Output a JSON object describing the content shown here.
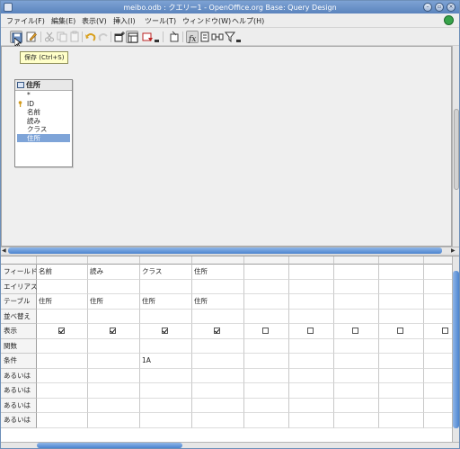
{
  "window": {
    "title": "meibo.odb : クエリー1 - OpenOffice.org Base: Query Design"
  },
  "menu": [
    "ファイル(F)",
    "編集(E)",
    "表示(V)",
    "挿入(I)",
    "ツール(T)",
    "ウィンドウ(W)",
    "ヘルプ(H)"
  ],
  "tooltip": "保存 (Ctrl+S)",
  "table_window": {
    "name": "住所",
    "fields": [
      "*",
      "ID",
      "名前",
      "読み",
      "クラス",
      "住所"
    ],
    "selected": "住所"
  },
  "grid": {
    "row_labels": [
      "フィールド",
      "エイリアス",
      "テーブル",
      "並べ替え",
      "表示",
      "関数",
      "条件",
      "あるいは",
      "あるいは",
      "あるいは",
      "あるいは"
    ],
    "columns": [
      {
        "field": "名前",
        "table": "住所",
        "visible": true,
        "criteria": ""
      },
      {
        "field": "読み",
        "table": "住所",
        "visible": true,
        "criteria": ""
      },
      {
        "field": "クラス",
        "table": "住所",
        "visible": true,
        "criteria": "1A"
      },
      {
        "field": "住所",
        "table": "住所",
        "visible": true,
        "criteria": ""
      },
      {
        "field": "",
        "table": "",
        "visible": false,
        "criteria": ""
      },
      {
        "field": "",
        "table": "",
        "visible": false,
        "criteria": ""
      },
      {
        "field": "",
        "table": "",
        "visible": false,
        "criteria": ""
      },
      {
        "field": "",
        "table": "",
        "visible": false,
        "criteria": ""
      },
      {
        "field": "",
        "table": "",
        "visible": false,
        "criteria": ""
      }
    ]
  },
  "colors": {
    "selection": "#7ea4d8",
    "scrollbar": "#4c84cf",
    "titlebar": "#5b84bd"
  }
}
